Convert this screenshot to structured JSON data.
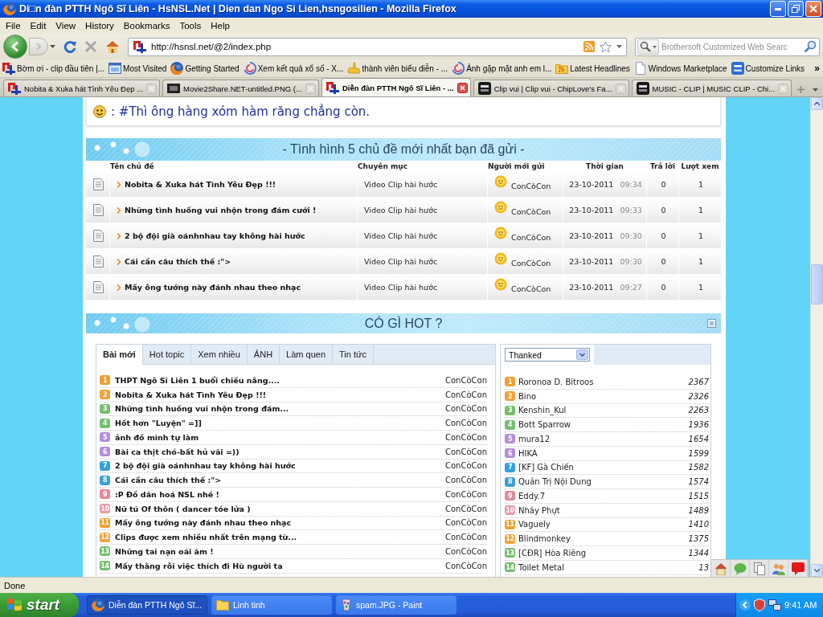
{
  "window": {
    "title": "Di□n đàn PTTH Ngô Sĩ Liên - HsNSL.Net | Dien dan Ngo Si Lien,hsngosilien - Mozilla Firefox"
  },
  "menu": [
    "File",
    "Edit",
    "View",
    "History",
    "Bookmarks",
    "Tools",
    "Help"
  ],
  "toolbar": {
    "url": "http://hsnsl.net/@2/index.php",
    "search": {
      "placeholder": "Brothersoft Customized Web Searc"
    }
  },
  "bookmarks": {
    "items": [
      "Bờm ơi - clip đầu tiên |...",
      "Most Visited",
      "Getting Started",
      "Xem kết quả xổ số - X...",
      "thành viên biểu diễn - ...",
      "Ảnh gặp mặt anh em l...",
      "Latest Headlines",
      "Windows Marketplace",
      "Customize Links"
    ],
    "more": "»"
  },
  "tabs": [
    {
      "label": "Nobita & Xuka hát Tình Yêu Đẹp ...",
      "selected": false
    },
    {
      "label": "Movie2Share.NET-untitled.PNG (...",
      "selected": false
    },
    {
      "label": "Diễn đàn PTTH Ngô Sĩ Liên - ...",
      "selected": true
    },
    {
      "label": "Clip vui | Clip vui - ChipLove's Fa...",
      "selected": false
    },
    {
      "label": "MUSIC - CLIP | MUSIC CLIP - Chi...",
      "selected": false
    }
  ],
  "page": {
    "notice": ": #Thì ông hàng xóm hàm răng chẳng còn.",
    "recent_topics": {
      "title": "- Tình hình 5 chủ đề mới nhất bạn đã gửi -",
      "columns": [
        "Tên chủ đề",
        "Chuyên mục",
        "Người mới gửi",
        "Thời gian",
        "Trả lời",
        "Lượt xem"
      ],
      "rows": [
        {
          "topic": "Nobita & Xuka hát Tình Yêu Đẹp !!!",
          "category": "Video Clip hài hước",
          "poster": "ConCòCon",
          "date": "23-10-2011",
          "time": "09:34",
          "replies": "0",
          "views": "1"
        },
        {
          "topic": "Những tình huống vui nhộn trong đám cưới !",
          "category": "Video Clip hài hước",
          "poster": "ConCòCon",
          "date": "23-10-2011",
          "time": "09:33",
          "replies": "0",
          "views": "1"
        },
        {
          "topic": "2 bộ đội già oánhnhau tay không hài hước",
          "category": "Video Clip hài hước",
          "poster": "ConCòCon",
          "date": "23-10-2011",
          "time": "09:30",
          "replies": "0",
          "views": "1"
        },
        {
          "topic": "Cái cần câu thích thế :\">",
          "category": "Video Clip hài hước",
          "poster": "ConCòCon",
          "date": "23-10-2011",
          "time": "09:30",
          "replies": "0",
          "views": "1"
        },
        {
          "topic": "Mấy ông tướng này đánh nhau theo nhạc",
          "category": "Video Clip hài hước",
          "poster": "ConCòCon",
          "date": "23-10-2011",
          "time": "09:27",
          "replies": "0",
          "views": "1"
        }
      ]
    },
    "hot": {
      "title": "CÓ GÌ HOT ?",
      "tabs": [
        {
          "label": "Bài mới",
          "selected": true
        },
        {
          "label": "Hot topic",
          "selected": false
        },
        {
          "label": "Xem nhiều",
          "selected": false
        },
        {
          "label": "ẢNH",
          "selected": false
        },
        {
          "label": "Làm quen",
          "selected": false
        },
        {
          "label": "Tin tức",
          "selected": false
        }
      ],
      "posts": [
        {
          "rank": "1",
          "color": "#f29f2e",
          "title": "THPT Ngô Sĩ Liên 1 buổi chiều nắng....",
          "author": "ConCòCon"
        },
        {
          "rank": "2",
          "color": "#f2a23a",
          "title": "Nobita & Xuka hát Tình Yêu Đẹp !!!",
          "author": "ConCòCon"
        },
        {
          "rank": "3",
          "color": "#73bf6e",
          "title": "Những tình huống vui nhộn trong đám...",
          "author": "ConCòCon"
        },
        {
          "rank": "4",
          "color": "#73bf6e",
          "title": "Hốt hơn \"Luyện\" =]]",
          "author": "ConCòCon"
        },
        {
          "rank": "5",
          "color": "#b58ddb",
          "title": "ảnh đồ mình tự làm",
          "author": "ConCòCon"
        },
        {
          "rank": "6",
          "color": "#b58ddb",
          "title": "Bài ca thịt chó-bất hủ vãi =))",
          "author": "ConCòCon"
        },
        {
          "rank": "7",
          "color": "#35a0dc",
          "title": "2 bộ đội già oánhnhau tay không hài hước",
          "author": "ConCòCon"
        },
        {
          "rank": "8",
          "color": "#3d9fd6",
          "title": "Cái cần câu thích thế :\">",
          "author": "ConCòCon"
        },
        {
          "rank": "9",
          "color": "#e38a98",
          "title": ":P Đồ dân hoá NSL nhé !",
          "author": "ConCòCon"
        },
        {
          "rank": "10",
          "color": "#e89aaa",
          "title": "Nữ tú Of thôn ( dancer tóe lửa )",
          "author": "ConCòCon"
        },
        {
          "rank": "11",
          "color": "#f29f2e",
          "title": "Mấy ông tướng này đánh nhau theo nhạc",
          "author": "ConCòCon"
        },
        {
          "rank": "12",
          "color": "#f2a23a",
          "title": "Clips được xem nhiều nhất trên mạng từ...",
          "author": "ConCòCon"
        },
        {
          "rank": "13",
          "color": "#73bf6e",
          "title": "Những tai nạn oái ăm !",
          "author": "ConCòCon"
        },
        {
          "rank": "14",
          "color": "#73bf6e",
          "title": "Mấy thằng rỗi việc thích đi Hù người ta",
          "author": "ConCòCon"
        }
      ],
      "ranking": {
        "filter": "Thanked",
        "members": [
          {
            "rank": "1",
            "color": "#f29f2e",
            "name": "Roronoa D. Bitroos",
            "count": "2367"
          },
          {
            "rank": "2",
            "color": "#f2a23a",
            "name": "Bino",
            "count": "2326"
          },
          {
            "rank": "3",
            "color": "#73bf6e",
            "name": "Kenshin_Kul",
            "count": "2263"
          },
          {
            "rank": "4",
            "color": "#73bf6e",
            "name": "Bott Sparrow",
            "count": "1936"
          },
          {
            "rank": "5",
            "color": "#b58ddb",
            "name": "mura12",
            "count": "1654"
          },
          {
            "rank": "6",
            "color": "#b58ddb",
            "name": "HIKA",
            "count": "1599"
          },
          {
            "rank": "7",
            "color": "#35a0dc",
            "name": "[KF] Gà Chiến",
            "count": "1582"
          },
          {
            "rank": "8",
            "color": "#3d9fd6",
            "name": "Quản Trị Nội Dung",
            "count": "1574"
          },
          {
            "rank": "9",
            "color": "#e38a98",
            "name": "Eddy.7",
            "count": "1515"
          },
          {
            "rank": "10",
            "color": "#e89aaa",
            "name": "Nháy Phựt",
            "count": "1489"
          },
          {
            "rank": "11",
            "color": "#f29f2e",
            "name": "Vaguely",
            "count": "1410"
          },
          {
            "rank": "12",
            "color": "#f2a23a",
            "name": "Blindmonkey",
            "count": "1375"
          },
          {
            "rank": "13",
            "color": "#73bf6e",
            "name": "[CĐR] Hòa Riêng",
            "count": "1344"
          },
          {
            "rank": "14",
            "color": "#73bf6e",
            "name": "Toilet Metal",
            "count": "13"
          }
        ]
      }
    }
  },
  "status_bar": "Done",
  "taskbar": {
    "start": "start",
    "tasks": [
      {
        "label": "Diễn đàn PTTH Ngô Sĩ...",
        "selected": true
      },
      {
        "label": "Linh tinh",
        "selected": false
      },
      {
        "label": "spam.JPG - Paint",
        "selected": false
      }
    ],
    "clock": "9:41 AM"
  }
}
